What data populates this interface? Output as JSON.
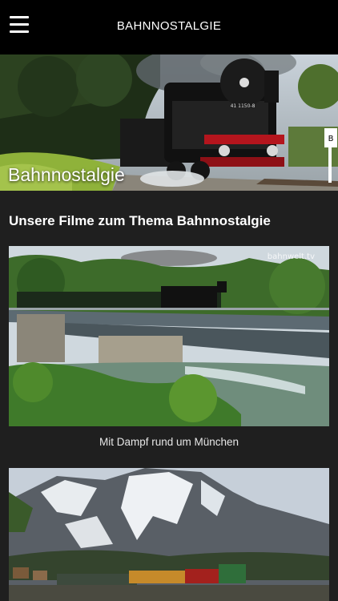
{
  "header": {
    "title": "BAHNNOSTALGIE",
    "menu_icon": "hamburger-menu-icon"
  },
  "hero": {
    "label": "Bahnnostalgie",
    "loco_number": "41 1150-8",
    "sign_text": "B"
  },
  "section": {
    "heading": "Unsere Filme zum Thema Bahnnostalgie"
  },
  "films": [
    {
      "caption": "Mit Dampf rund um München",
      "watermark": "bahnwelt.tv"
    },
    {
      "caption": ""
    }
  ],
  "colors": {
    "topbar_bg": "#000000",
    "content_bg": "#1f1f1f",
    "text": "#ffffff"
  }
}
